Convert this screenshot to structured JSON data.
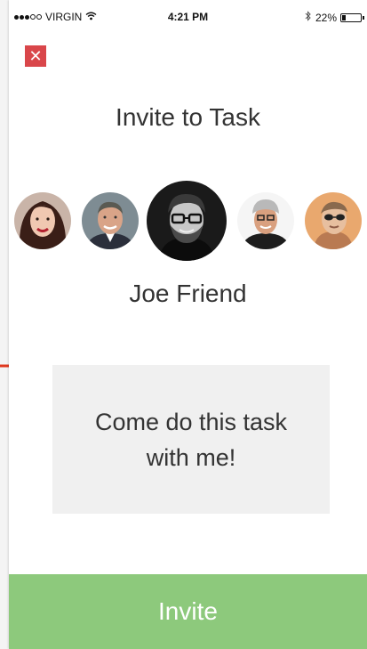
{
  "status_bar": {
    "carrier": "VIRGIN",
    "time": "4:21 PM",
    "battery_percent": "22%",
    "battery_level": 0.22,
    "icons": [
      "signal-dots-icon",
      "wifi-icon",
      "bluetooth-icon",
      "battery-icon"
    ]
  },
  "header": {
    "close_icon": "close-icon",
    "title": "Invite to Task"
  },
  "friends": {
    "avatar_count": 5,
    "selected_index": 2,
    "selected_name": "Joe Friend"
  },
  "message": {
    "text": "Come do this task with me!"
  },
  "invite_button": {
    "label": "Invite"
  },
  "colors": {
    "close": "#d9464a",
    "invite": "#8dc97c",
    "message_bg": "#f0f0f0",
    "arrow": "#e0391f"
  }
}
